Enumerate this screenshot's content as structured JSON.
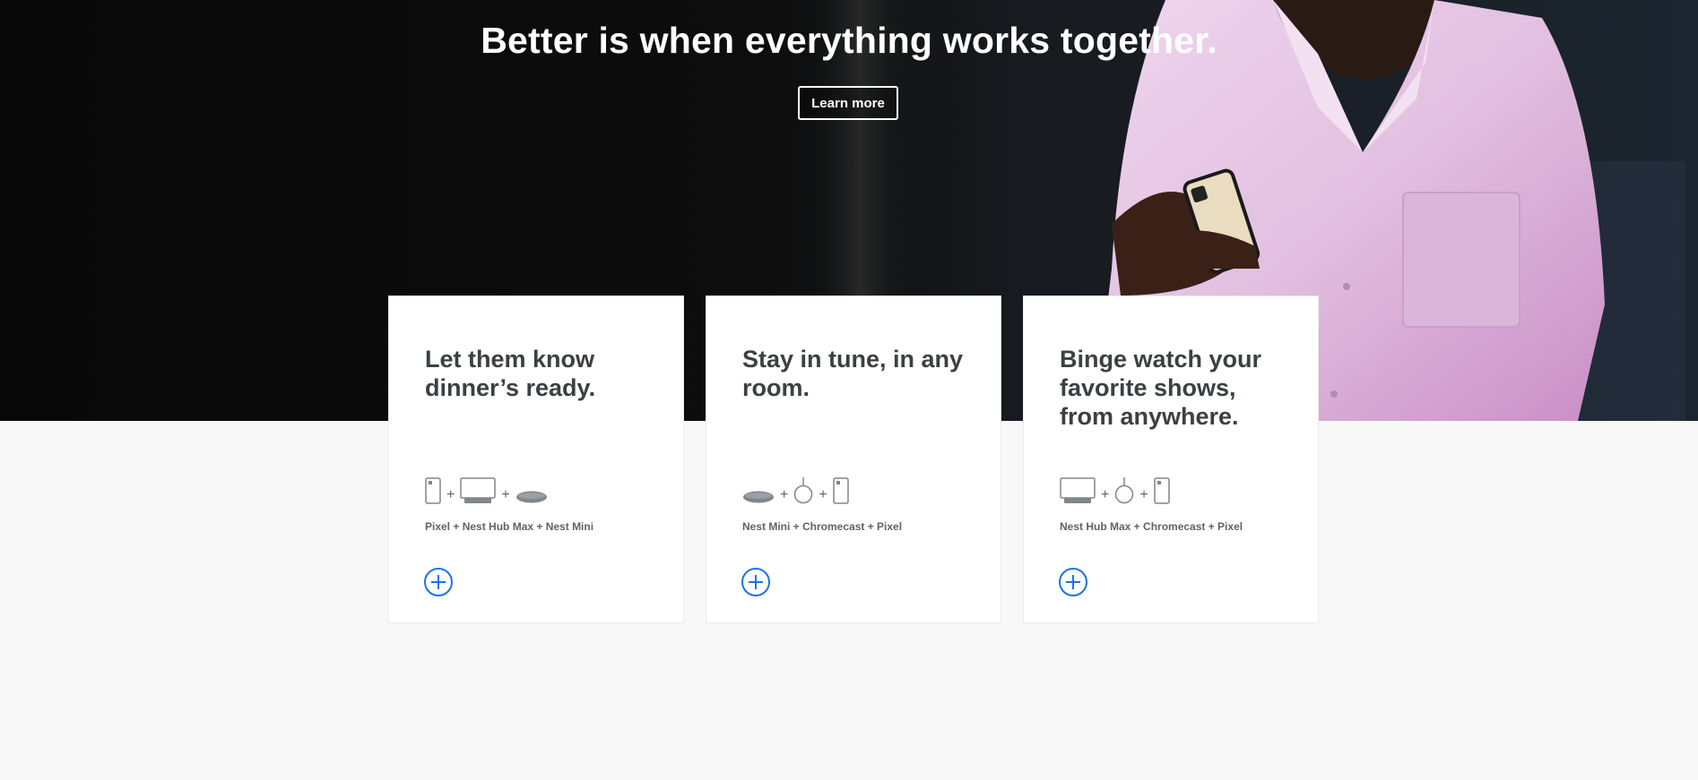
{
  "hero": {
    "title": "Better is when everything works together.",
    "learn_more_label": "Learn more"
  },
  "cards": [
    {
      "title": "Let them know dinner’s ready.",
      "devices": [
        "pixel-phone-icon",
        "nest-hub-max-icon",
        "nest-mini-icon"
      ],
      "products": "Pixel + Nest Hub Max + Nest Mini"
    },
    {
      "title": "Stay in tune, in any room.",
      "devices": [
        "nest-mini-icon",
        "chromecast-icon",
        "pixel-phone-icon"
      ],
      "products": "Nest Mini + Chromecast + Pixel"
    },
    {
      "title": "Binge watch your favorite shows, from anywhere.",
      "devices": [
        "nest-hub-max-icon",
        "chromecast-icon",
        "pixel-phone-icon"
      ],
      "products": "Nest Hub Max + Chromecast + Pixel"
    }
  ],
  "plus_sign": "+",
  "colors": {
    "accent": "#1a73e8",
    "card_title": "#3c4043",
    "muted": "#5f6368",
    "hero_bg": "#0b0b0b",
    "shirt": "#e6c3e3",
    "page_bg": "#f8f8f8"
  }
}
